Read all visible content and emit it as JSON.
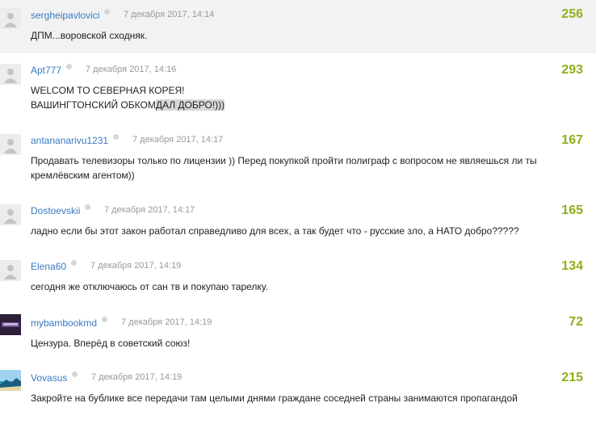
{
  "comments": [
    {
      "author": "sergheipavlovici",
      "date": "7 декабря 2017, 14:14",
      "rating": "256",
      "text": [
        "ДПМ...воровской сходняк."
      ]
    },
    {
      "author": "Apt777",
      "date": "7 декабря 2017, 14:16",
      "rating": "293",
      "text": [
        "WELCOM TO СЕВЕРНАЯ КОРЕЯ!",
        "ВАШИНГТОНСКИЙ ОБКОМ",
        "ДАЛ ДОБРО!)))"
      ]
    },
    {
      "author": "antananarivu1231",
      "date": "7 декабря 2017, 14:17",
      "rating": "167",
      "text": [
        "Продавать телевизоры только по лицензии )) Перед покупкой пройти полиграф с вопросом не являешься ли ты",
        "кремлёвским агентом))"
      ]
    },
    {
      "author": "Dostoevskii",
      "date": "7 декабря 2017, 14:17",
      "rating": "165",
      "text": [
        "ладно если бы этот закон работал справедливо для всех, а так будет что - русские зло, а НАТО добро?????"
      ]
    },
    {
      "author": "Elena60",
      "date": "7 декабря 2017, 14:19",
      "rating": "134",
      "text": [
        "сегодня же отключаюсь от сан тв и покупаю тарелку."
      ]
    },
    {
      "author": "mybambookmd",
      "date": "7 декабря 2017, 14:19",
      "rating": "72",
      "text": [
        "Цензура. Вперёд в советский союз!"
      ]
    },
    {
      "author": "Vovasus",
      "date": "7 декабря 2017, 14:19",
      "rating": "215",
      "text": [
        "Закройте на бублике все передачи там целыми днями граждане соседней страны занимаются пропагандой"
      ]
    }
  ]
}
